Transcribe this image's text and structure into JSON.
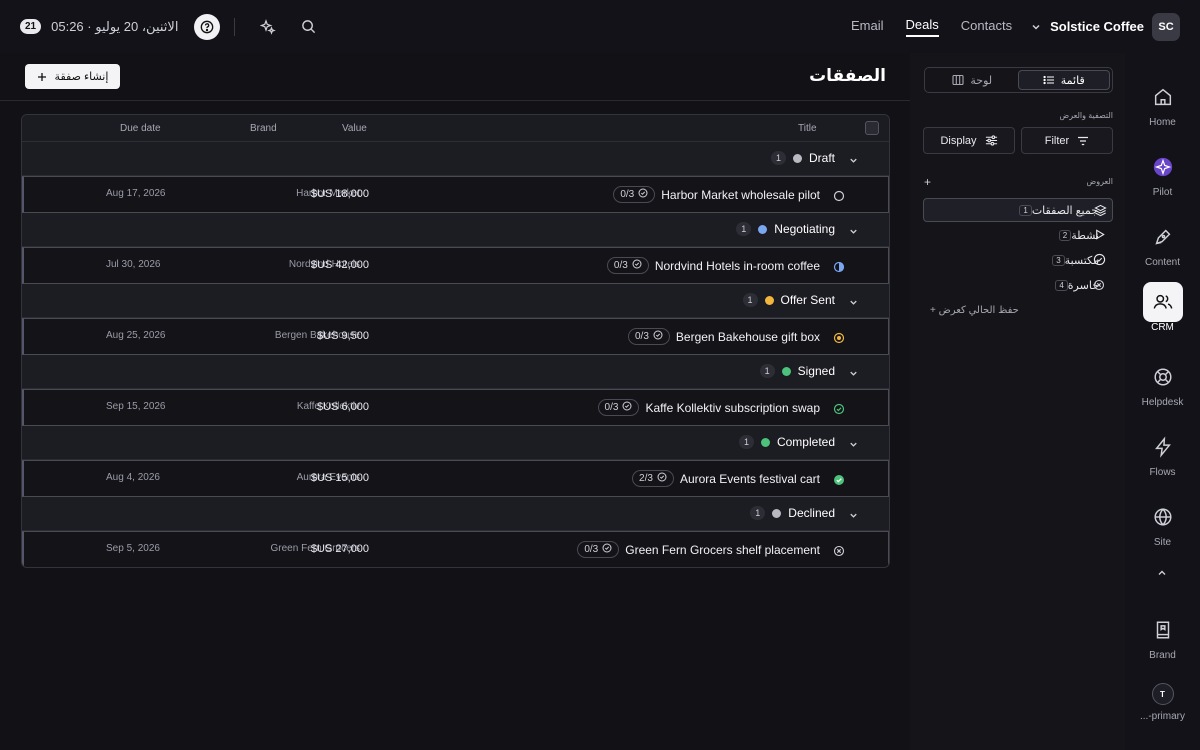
{
  "topbar": {
    "day_badge": "21",
    "date_text": "الاثنين، 20 يوليو  ·  05:26",
    "nav": [
      "Email",
      "Deals",
      "Contacts"
    ],
    "active_nav": "Deals",
    "workspace_name": "Solstice Coffee",
    "workspace_initials": "SC"
  },
  "main": {
    "page_title": "الصفقات",
    "create_label": "إنشاء صفقة",
    "columns": {
      "title": "Title",
      "value": "Value",
      "brand": "Brand",
      "due": "Due date"
    }
  },
  "groups": [
    {
      "label": "Draft",
      "count": "1",
      "color": "#b9b9c1",
      "deal": {
        "title": "Harbor Market wholesale pilot",
        "tasks": "0/3",
        "value": "$US 18,000",
        "brand": "Harbor Market",
        "due": "Aug 17, 2026",
        "status": "empty-circle-icon"
      }
    },
    {
      "label": "Negotiating",
      "count": "1",
      "color": "#7aa7f0",
      "deal": {
        "title": "Nordvind Hotels in-room coffee",
        "tasks": "0/3",
        "value": "$US 42,000",
        "brand": "Nordvind Hotels",
        "due": "Jul 30, 2026",
        "status": "half-circle-icon"
      }
    },
    {
      "label": "Offer Sent",
      "count": "1",
      "color": "#f2b63c",
      "deal": {
        "title": "Bergen Bakehouse gift box",
        "tasks": "0/3",
        "value": "$US 9,500",
        "brand": "Bergen Bakehouse",
        "due": "Aug 25, 2026",
        "status": "target-circle-icon"
      }
    },
    {
      "label": "Signed",
      "count": "1",
      "color": "#4cc27a",
      "deal": {
        "title": "Kaffe Kollektiv subscription swap",
        "tasks": "0/3",
        "value": "$US 6,000",
        "brand": "Kaffe Kollektiv",
        "due": "Sep 15, 2026",
        "status": "check-circle-outline-icon"
      }
    },
    {
      "label": "Completed",
      "count": "1",
      "color": "#4cc27a",
      "deal": {
        "title": "Aurora Events festival cart",
        "tasks": "2/3",
        "value": "$US 15,000",
        "brand": "Aurora Events",
        "due": "Aug 4, 2026",
        "status": "check-circle-filled-icon"
      }
    },
    {
      "label": "Declined",
      "count": "1",
      "color": "#b9b9c1",
      "deal": {
        "title": "Green Fern Grocers shelf placement",
        "tasks": "0/3",
        "value": "$US 27,000",
        "brand": "Green Fern Grocers",
        "due": "Sep 5, 2026",
        "status": "x-circle-icon"
      }
    }
  ],
  "side_panel": {
    "view_list_label": "قائمة",
    "view_board_label": "لوحة",
    "filter_display_heading": "التصفية والعرض",
    "filter_label": "Filter",
    "display_label": "Display",
    "views_heading": "العروض",
    "views_add": "+",
    "views": [
      {
        "name": "جميع الصفقات",
        "count": "1",
        "icon": "layers-icon",
        "active": true
      },
      {
        "name": "نشطة",
        "count": "2",
        "icon": "play-icon",
        "active": false
      },
      {
        "name": "مكتسبة",
        "count": "3",
        "icon": "check-circle-icon",
        "active": false
      },
      {
        "name": "خاسرة",
        "count": "4",
        "icon": "x-circle-icon",
        "active": false
      }
    ],
    "save_view": "+ حفظ الحالي كعرض"
  },
  "rail": {
    "items": [
      {
        "label": "Home",
        "icon": "home-icon"
      },
      {
        "label": "Pilot",
        "icon": "pilot-icon"
      },
      {
        "label": "Content",
        "icon": "pen-icon"
      },
      {
        "label": "CRM",
        "icon": "users-icon",
        "active": true
      },
      {
        "label": "Helpdesk",
        "icon": "lifebuoy-icon"
      },
      {
        "label": "Flows",
        "icon": "bolt-icon"
      },
      {
        "label": "Site",
        "icon": "globe-icon"
      },
      {
        "label": "Brand",
        "icon": "book-icon"
      }
    ],
    "account_initial": "T",
    "account_label": "...-primary"
  }
}
